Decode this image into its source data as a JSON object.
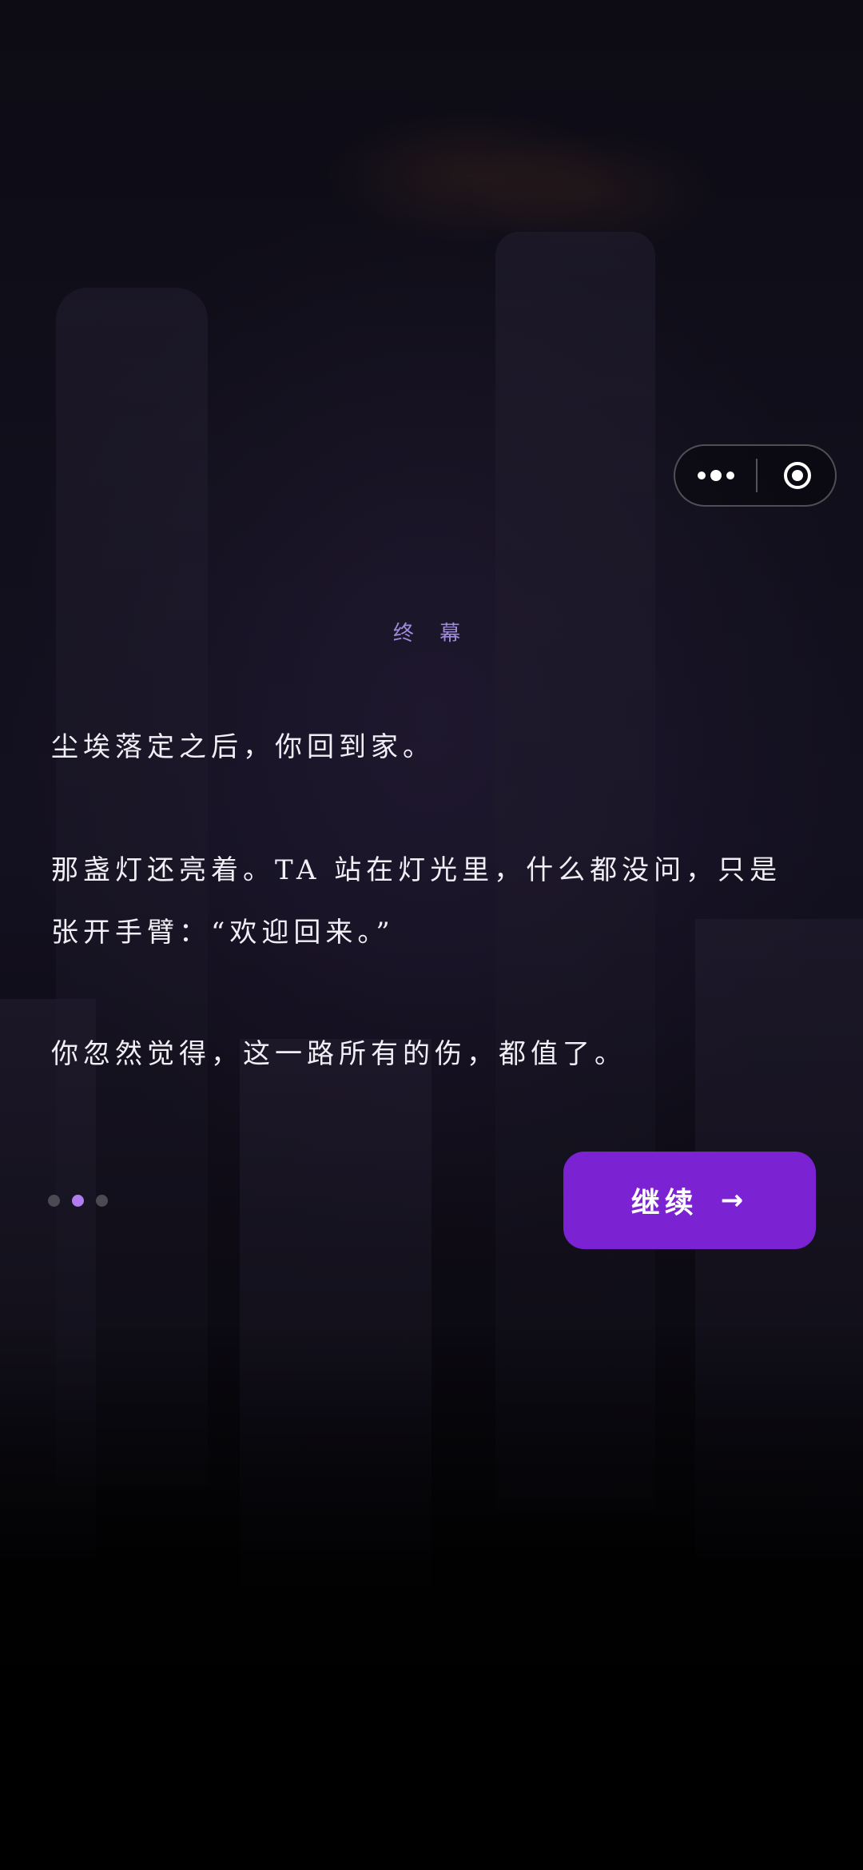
{
  "chapter": {
    "title": "终 幕"
  },
  "story": {
    "paragraphs": [
      "尘埃落定之后，你回到家。",
      "那盏灯还亮着。TA 站在灯光里，什么都没问，只是张开手臂：“欢迎回来。”",
      "你忽然觉得，这一路所有的伤，都值了。"
    ]
  },
  "progress": {
    "total": 3,
    "current": 2
  },
  "continue_button": {
    "label": "继续",
    "arrow": "→"
  },
  "capsule": {
    "more_icon": "more-dots-icon",
    "close_icon": "target-circle-icon"
  },
  "colors": {
    "accent": "#7b23d3",
    "chapter_text": "#9d8ad8",
    "active_dot": "#b07cf0",
    "inactive_dot": "#4b4a52",
    "body_text": "#f1eff5"
  }
}
